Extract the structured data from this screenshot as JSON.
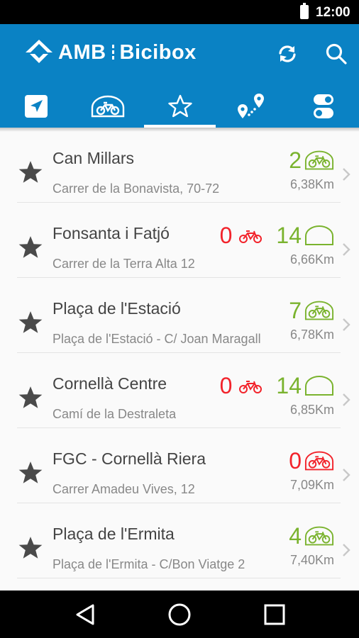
{
  "status_bar": {
    "time": "12:00",
    "battery_icon": "battery-full-icon"
  },
  "app_bar": {
    "brand_primary": "AMB",
    "brand_secondary": "Bicibox",
    "logo_icon": "amb-diamond-logo",
    "actions": [
      {
        "name": "refresh",
        "icon": "refresh-icon"
      },
      {
        "name": "search",
        "icon": "search-icon"
      }
    ],
    "background_color": "#0a82c4"
  },
  "tabs": [
    {
      "name": "nearby",
      "icon": "navigation-arrow-icon",
      "selected": false
    },
    {
      "name": "bicibox-stations",
      "icon": "bike-parking-icon",
      "selected": false
    },
    {
      "name": "favorites",
      "icon": "star-outline-icon",
      "selected": true
    },
    {
      "name": "route",
      "icon": "route-pins-icon",
      "selected": false
    },
    {
      "name": "settings",
      "icon": "toggle-settings-icon",
      "selected": false
    }
  ],
  "colors": {
    "available": "#7ab32e",
    "empty": "#f2232b",
    "text": "#444444",
    "muted": "#888888"
  },
  "stations": [
    {
      "name": "Can Millars",
      "address": "Carrer de la Bonavista, 70-72",
      "distance": "6,38Km",
      "bikes": "2",
      "bikes_status": "available",
      "free_slots": ""
    },
    {
      "name": "Fonsanta i Fatjó",
      "address": "Carrer de la Terra Alta 12",
      "distance": "6,66Km",
      "bikes": "0",
      "bikes_status": "empty",
      "free_slots": "14"
    },
    {
      "name": "Plaça de l'Estació",
      "address": "Plaça de l'Estació - C/ Joan Maragall",
      "distance": "6,78Km",
      "bikes": "7",
      "bikes_status": "available",
      "free_slots": ""
    },
    {
      "name": "Cornellà Centre",
      "address": "Camí de la Destraleta",
      "distance": "6,85Km",
      "bikes": "0",
      "bikes_status": "empty",
      "free_slots": "14"
    },
    {
      "name": "FGC - Cornellà Riera",
      "address": "Carrer Amadeu Vives, 12",
      "distance": "7,09Km",
      "bikes": "0",
      "bikes_status": "empty-box",
      "free_slots": ""
    },
    {
      "name": "Plaça de l'Ermita",
      "address": "Plaça de l'Ermita - C/Bon Viatge 2",
      "distance": "7,40Km",
      "bikes": "4",
      "bikes_status": "available",
      "free_slots": ""
    }
  ],
  "nav_bar": [
    {
      "name": "back",
      "icon": "back-triangle-icon"
    },
    {
      "name": "home",
      "icon": "home-circle-icon"
    },
    {
      "name": "recents",
      "icon": "recents-square-icon"
    }
  ]
}
